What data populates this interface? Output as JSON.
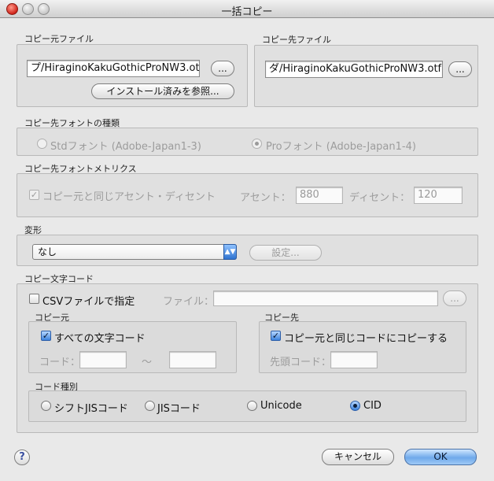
{
  "window": {
    "title": "一括コピー"
  },
  "source_file": {
    "label": "コピー元ファイル",
    "path": "プ/HiraginoKakuGothicProNW3.otf",
    "browse_label": "...",
    "installed_button": "インストール済みを参照..."
  },
  "dest_file": {
    "label": "コピー先ファイル",
    "path": "ダ/HiraginoKakuGothicProNW3.otf",
    "browse_label": "..."
  },
  "font_type": {
    "label": "コピー先フォントの種類",
    "options": [
      {
        "label": "Stdフォント (Adobe-Japan1-3)",
        "selected": false
      },
      {
        "label": "Proフォント (Adobe-Japan1-4)",
        "selected": true
      }
    ]
  },
  "metrics": {
    "label": "コピー先フォントメトリクス",
    "same_as_source_label": "コピー元と同じアセント・ディセント",
    "same_as_source_checked": true,
    "ascent_label": "アセント：",
    "ascent_value": "880",
    "descent_label": "ディセント：",
    "descent_value": "120"
  },
  "transform": {
    "label": "変形",
    "selected": "なし",
    "settings_button": "設定..."
  },
  "char_code": {
    "label": "コピー文字コード",
    "csv_label": "CSVファイルで指定",
    "csv_checked": false,
    "file_label": "ファイル：",
    "file_value": "",
    "browse_label": "...",
    "source": {
      "label": "コピー元",
      "all_codes_label": "すべての文字コード",
      "all_codes_checked": true,
      "code_label": "コード：",
      "range_sep": "〜"
    },
    "dest": {
      "label": "コピー先",
      "same_code_label": "コピー元と同じコードにコピーする",
      "same_code_checked": true,
      "start_code_label": "先頭コード："
    },
    "code_type": {
      "label": "コード種別",
      "options": [
        {
          "label": "シフトJISコード",
          "selected": false
        },
        {
          "label": "JISコード",
          "selected": false
        },
        {
          "label": "Unicode",
          "selected": false
        },
        {
          "label": "CID",
          "selected": true
        }
      ]
    }
  },
  "footer": {
    "help": "?",
    "cancel": "キャンセル",
    "ok": "OK"
  }
}
